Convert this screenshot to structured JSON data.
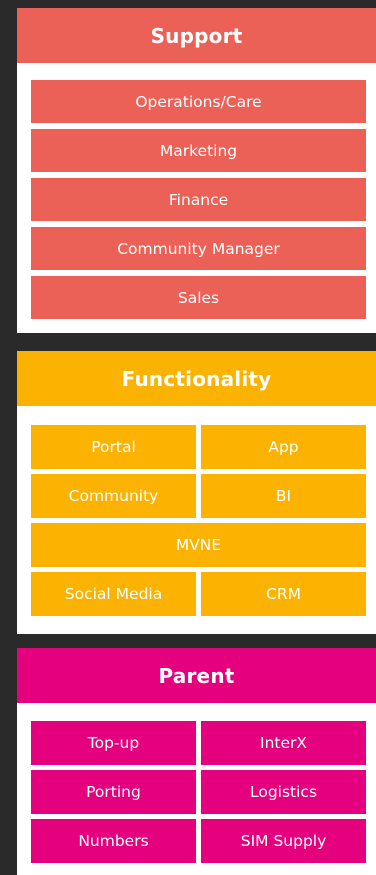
{
  "colors": {
    "background": "#2a2a2a",
    "support": "#ec6157",
    "functionality": "#fcb200",
    "parent": "#e5007e",
    "panel": "#ffffff",
    "text": "#ffffff"
  },
  "support": {
    "title": "Support",
    "items": [
      "Operations/Care",
      "Marketing",
      "Finance",
      "Community Manager",
      "Sales"
    ]
  },
  "functionality": {
    "title": "Functionality",
    "items": [
      "Portal",
      "App",
      "Community",
      "BI",
      "MVNE",
      "Social Media",
      "CRM"
    ]
  },
  "parent": {
    "title": "Parent",
    "items": [
      "Top-up",
      "InterX",
      "Porting",
      "Logistics",
      "Numbers",
      "SIM Supply"
    ]
  }
}
